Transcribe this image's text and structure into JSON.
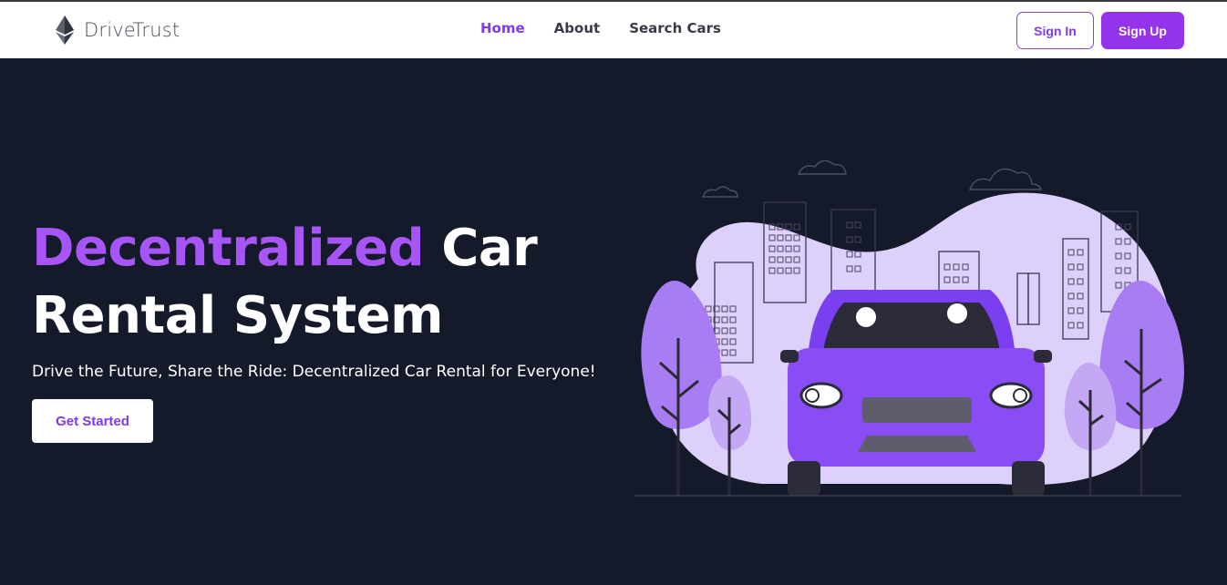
{
  "brand": {
    "name": "DriveTrust",
    "logo_icon": "ethereum-diamond-icon"
  },
  "nav": {
    "items": [
      {
        "label": "Home",
        "active": true
      },
      {
        "label": "About",
        "active": false
      },
      {
        "label": "Search Cars",
        "active": false
      }
    ]
  },
  "auth": {
    "signin_label": "Sign In",
    "signup_label": "Sign Up"
  },
  "hero": {
    "title_accent": "Decentralized",
    "title_rest_1": "Car",
    "title_rest_2": "Rental System",
    "subtitle": "Drive the Future, Share the Ride: Decentralized Car Rental for Everyone!",
    "cta_label": "Get Started"
  },
  "colors": {
    "accent": "#9333ea",
    "accent_text": "#7e3af2",
    "title_accent": "#a855f7",
    "background": "#141a2a",
    "header": "#ffffff"
  }
}
